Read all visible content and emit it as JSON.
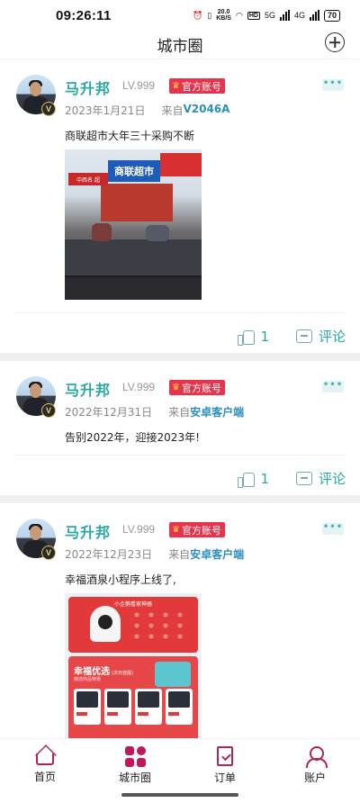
{
  "status_bar": {
    "time": "09:26:11",
    "net_speed_top": "20.0",
    "net_speed_bottom": "KB/S",
    "hd_label": "HD",
    "network_5g": "5G",
    "network_4g": "4G",
    "battery": "70"
  },
  "header": {
    "title": "城市圈"
  },
  "posts": [
    {
      "username": "马升邦",
      "level": "LV.999",
      "official_label": "官方账号",
      "verified_badge": "V",
      "more": "•••",
      "date": "2023年1月21日",
      "from_label": "来自",
      "source": "V2046A",
      "text": "商联超市大年三十采购不断",
      "photo_sign_main": "商联超市",
      "photo_sign_side": "中西名 超",
      "likes": "1",
      "comment_label": "评论"
    },
    {
      "username": "马升邦",
      "level": "LV.999",
      "official_label": "官方账号",
      "verified_badge": "V",
      "more": "•••",
      "date": "2022年12月31日",
      "from_label": "来自",
      "source": "安卓客户端",
      "text": "告别2022年，迎接2023年!",
      "likes": "1",
      "comment_label": "评论"
    },
    {
      "username": "马升邦",
      "level": "LV.999",
      "official_label": "官方账号",
      "verified_badge": "V",
      "more": "•••",
      "date": "2022年12月23日",
      "from_label": "来自",
      "source": "安卓客户端",
      "text": "幸福酒泉小程序上线了,",
      "mini_top_title": "小企鹅看家神器",
      "mini_section_title": "幸福优选",
      "mini_section_sub": "(次日自提)",
      "mini_section_note": "精选商品特惠"
    }
  ],
  "tabbar": {
    "items": [
      {
        "label": "首页",
        "icon": "home-icon"
      },
      {
        "label": "城市圈",
        "icon": "grid-icon"
      },
      {
        "label": "订单",
        "icon": "order-icon"
      },
      {
        "label": "账户",
        "icon": "user-icon"
      }
    ],
    "active_color": "#c0185a",
    "accent_color": "#2aa9a2"
  }
}
